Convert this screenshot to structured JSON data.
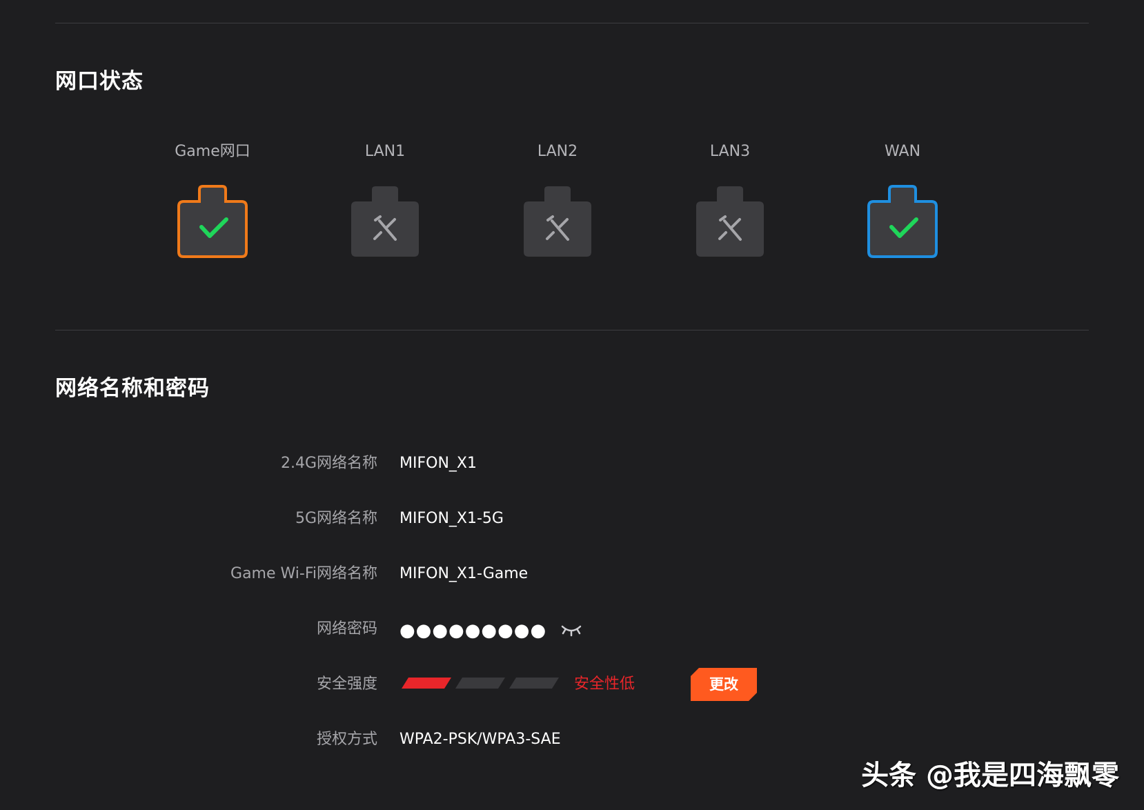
{
  "sections": {
    "port_status_title": "网口状态",
    "wifi_title": "网络名称和密码"
  },
  "ports": [
    {
      "label": "Game网口",
      "connected": true,
      "color": "#f07a1a"
    },
    {
      "label": "LAN1",
      "connected": false
    },
    {
      "label": "LAN2",
      "connected": false
    },
    {
      "label": "LAN3",
      "connected": false
    },
    {
      "label": "WAN",
      "connected": true,
      "color": "#1f8fe0"
    }
  ],
  "colors": {
    "background": "#1e1e20",
    "port_idle": "#3d3d40",
    "check": "#1fd65a",
    "strength_active": "#e8262a",
    "button": "#ff5a1f"
  },
  "wifi": {
    "name_24g_label": "2.4G网络名称",
    "name_24g_value": "MIFON_X1",
    "name_5g_label": "5G网络名称",
    "name_5g_value": "MIFON_X1-5G",
    "name_game_label": "Game Wi-Fi网络名称",
    "name_game_value": "MIFON_X1-Game",
    "password_label": "网络密码",
    "password_value": "●●●●●●●●●",
    "password_toggle_icon": "eye-closed-icon",
    "strength_label": "安全强度",
    "strength_level": 1,
    "strength_total": 3,
    "strength_text": "安全性低",
    "change_button": "更改",
    "auth_label": "授权方式",
    "auth_value": "WPA2-PSK/WPA3-SAE"
  },
  "watermark": "头条 @我是四海飘零"
}
